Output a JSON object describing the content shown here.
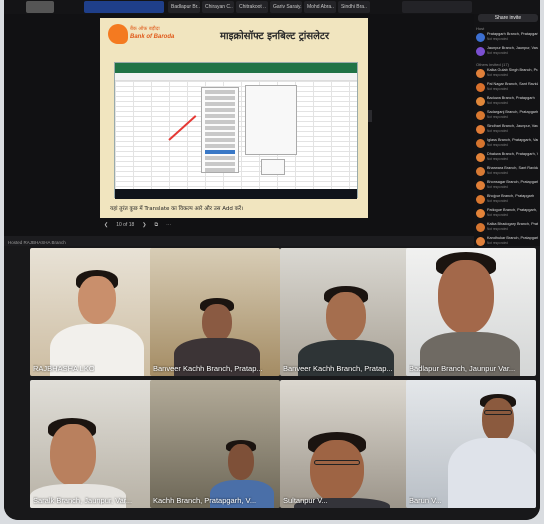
{
  "top_bar": {
    "participant_tabs": [
      "Badlapur Br..",
      "Chirayan C..",
      "Chitrakoot ..",
      "Gariv Saraiy..",
      "Mohd Abra..",
      "Sindhi Bra.."
    ]
  },
  "slide": {
    "bank_hindi": "बैंक ऑफ़ बड़ौदा",
    "bank_english": "Bank of Baroda",
    "title": "माइक्रोसॉफ्ट इनबिल्ट ट्रांसलेटर",
    "caption": "यहां तुरंत कुछ में Translate का विकल्प आरे और उस Add करें।",
    "page_indicator": "10 of 18",
    "presenter_label": "Hosted RAJBHASHA Branch"
  },
  "sidebar": {
    "share_button": "Share invite",
    "section_host": "Host",
    "section_others": "Others invited (17)",
    "participants": [
      {
        "name": "Pratapgarh Branch, Pratapgarh",
        "sub": "Not responded",
        "color": "#3c6fd1"
      },
      {
        "name": "Jaunpur Branch, Jaunpur, Varanasi",
        "sub": "Not responded",
        "color": "#7a4fd0"
      },
      {
        "name": "Kalka Gulab Singh Branch, Pratapgarh",
        "sub": "Not responded",
        "color": "#e0803a"
      },
      {
        "name": "Pal Nagar Branch, Sant Ravidas",
        "sub": "Not responded",
        "color": "#d8702c"
      },
      {
        "name": "Baduwa Branch, Pratapgarh",
        "sub": "Not responded",
        "color": "#e0873a"
      },
      {
        "name": "Sadarganj Branch, Pratapgarh",
        "sub": "Not responded",
        "color": "#d87830"
      },
      {
        "name": "Sindhari Branch, Jaunpur, Varanasi",
        "sub": "Not responded",
        "color": "#e07b36"
      },
      {
        "name": "Iglass Branch, Pratapgarh, Vara",
        "sub": "Not responded",
        "color": "#d6742e"
      },
      {
        "name": "Dhakwa Branch, Pratapgarh, Var",
        "sub": "Not responded",
        "color": "#e28238"
      },
      {
        "name": "Bharwara Branch, Sant Ravidas",
        "sub": "Not responded",
        "color": "#d87a34"
      },
      {
        "name": "Bhonsagar Branch, Pratapgarh",
        "sub": "Not responded",
        "color": "#e07f37"
      },
      {
        "name": "Bhojpur Branch, Pratapgarh",
        "sub": "Not responded",
        "color": "#d9772f"
      },
      {
        "name": "Patlogue Branch, Pratapgarh, V",
        "sub": "Not responded",
        "color": "#e38339"
      },
      {
        "name": "Kalka Bhadogary Branch, Pratap",
        "sub": "Not responded",
        "color": "#d57530"
      },
      {
        "name": "Kandhukar Branch, Pratapgarh",
        "sub": "Not responded",
        "color": "#e0803a"
      }
    ]
  },
  "gallery": {
    "tiles": [
      {
        "label": "RAJBHASHA LKO",
        "bg": "#cdbda2"
      },
      {
        "label": "Banveer Kachh Branch, Pratap...",
        "bg": "#b5a27c"
      },
      {
        "label": "Banveer Kachh Branch, Pratap...",
        "bg": "#b7b2a8"
      },
      {
        "label": "Badlapur Branch, Jaunpur Var...",
        "bg": "#dddedd"
      },
      {
        "label": "Saralk Branch, Jaunpur, Var...",
        "bg": "#c4c0b6"
      },
      {
        "label": "Kachh Branch, Pratapgarh, V...",
        "bg": "#8c8473"
      },
      {
        "label": "Sultanpur V...",
        "bg": "#bdb6ad"
      },
      {
        "label": "Barun V...",
        "bg": "#d2d6db"
      }
    ]
  }
}
